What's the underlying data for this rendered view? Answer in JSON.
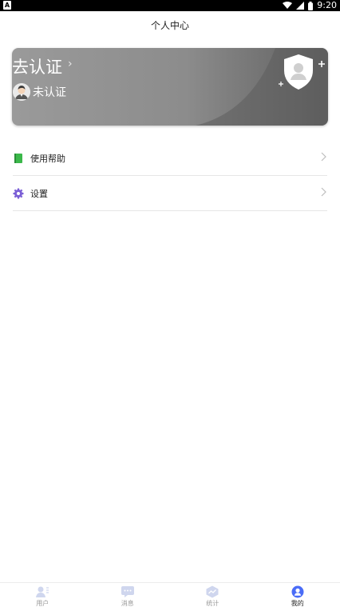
{
  "status_bar": {
    "time": "9:20"
  },
  "header": {
    "title": "个人中心"
  },
  "card": {
    "title": "去认证",
    "status": "未认证"
  },
  "menu": [
    {
      "label": "使用帮助",
      "icon": "book-icon",
      "color": "#3bb84a"
    },
    {
      "label": "设置",
      "icon": "gear-icon",
      "color": "#7b5fd6"
    }
  ],
  "tabs": [
    {
      "label": "用户",
      "icon": "user-list-icon",
      "active": false
    },
    {
      "label": "消息",
      "icon": "chat-bubble-icon",
      "active": false
    },
    {
      "label": "统计",
      "icon": "chart-icon",
      "active": false
    },
    {
      "label": "我的",
      "icon": "profile-icon",
      "active": true
    }
  ],
  "colors": {
    "accent": "#4a6cf7",
    "inactive_tab": "#cfd6ee",
    "card_dark": "#5f5f5f"
  }
}
